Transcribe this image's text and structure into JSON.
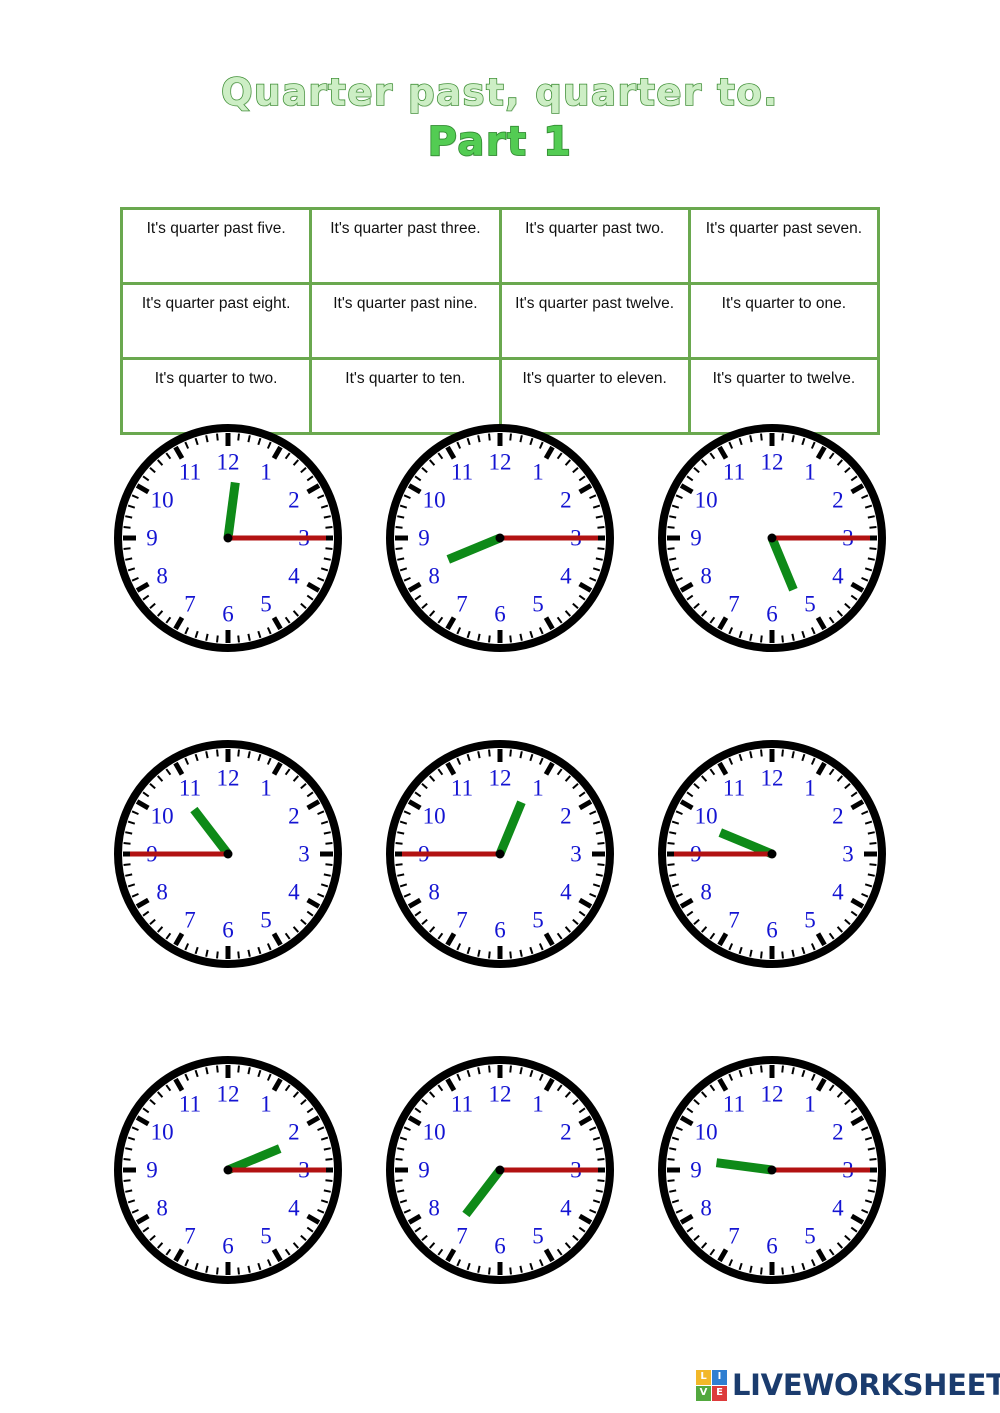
{
  "worksheet": {
    "title_line_1": "Quarter past, quarter to.",
    "title_line_2": "Part 1",
    "title_fill_color": "#cdeec5",
    "title_outline_color": "#3f8f36",
    "title_part_fill_color": "#53cc53"
  },
  "word_bank": {
    "border_color": "#6aa84f",
    "rows": [
      [
        "It's quarter past five.",
        "It's quarter past three.",
        "It's quarter past two.",
        "It's quarter past seven."
      ],
      [
        "It's quarter past eight.",
        "It's quarter past nine.",
        "It's quarter past twelve.",
        "It's quarter to one."
      ],
      [
        "It's quarter to two.",
        "It's quarter to ten.",
        "It's quarter to eleven.",
        "It's quarter to twelve."
      ]
    ]
  },
  "clock_face": {
    "numerals": [
      "12",
      "1",
      "2",
      "3",
      "4",
      "5",
      "6",
      "7",
      "8",
      "9",
      "10",
      "11"
    ],
    "numeral_color": "#1414d2",
    "rim_color": "#000000",
    "hour_hand_color": "#0e8a18",
    "minute_hand_color": "#b21212",
    "dial_color": "#ffffff"
  },
  "clocks": [
    {
      "id": "clock-1",
      "hour": 12,
      "minute": 15,
      "hour_angle": 7.5,
      "minute_angle": 90
    },
    {
      "id": "clock-2",
      "hour": 8,
      "minute": 15,
      "hour_angle": 247.5,
      "minute_angle": 90
    },
    {
      "id": "clock-3",
      "hour": 5,
      "minute": 15,
      "hour_angle": 157.5,
      "minute_angle": 90
    },
    {
      "id": "clock-4",
      "hour": 10,
      "minute": 45,
      "hour_angle": 322.5,
      "minute_angle": 270
    },
    {
      "id": "clock-5",
      "hour": 12,
      "minute": 45,
      "hour_angle": 22.5,
      "minute_angle": 270
    },
    {
      "id": "clock-6",
      "hour": 9,
      "minute": 45,
      "hour_angle": 292.5,
      "minute_angle": 270
    },
    {
      "id": "clock-7",
      "hour": 2,
      "minute": 15,
      "hour_angle": 67.5,
      "minute_angle": 90
    },
    {
      "id": "clock-8",
      "hour": 7,
      "minute": 15,
      "hour_angle": 217.5,
      "minute_angle": 90
    },
    {
      "id": "clock-9",
      "hour": 9,
      "minute": 15,
      "hour_angle": 277.5,
      "minute_angle": 90
    }
  ],
  "footer": {
    "logo_text": "LIVEWORKSHEETS",
    "logo_text_color": "#1b3c6e",
    "tiles": [
      {
        "letter": "L",
        "color": "#f2b829"
      },
      {
        "letter": "I",
        "color": "#2f7fd1"
      },
      {
        "letter": "V",
        "color": "#52a83e"
      },
      {
        "letter": "E",
        "color": "#dd3b3b"
      }
    ]
  }
}
